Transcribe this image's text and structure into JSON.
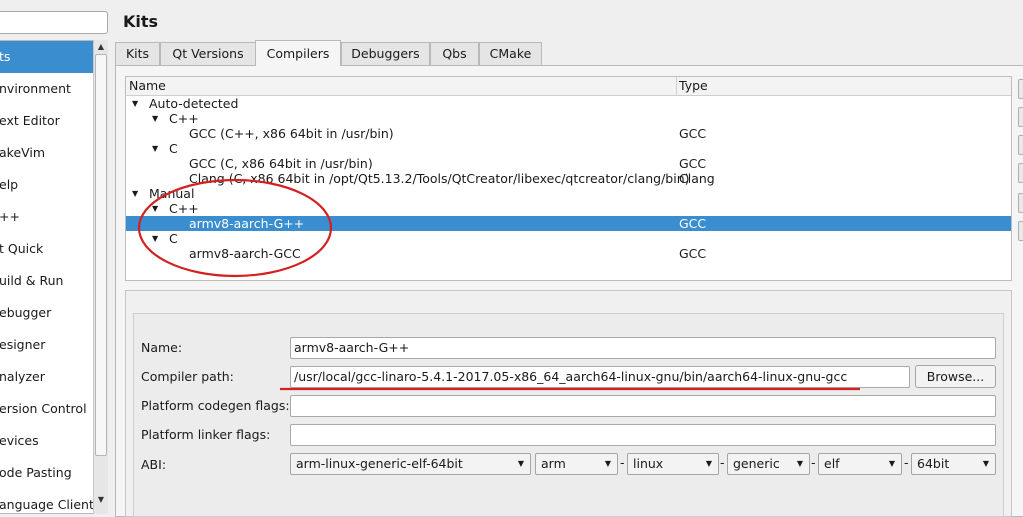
{
  "page_title": "Kits",
  "sidebar": {
    "items": [
      {
        "label": "ts",
        "selected": true
      },
      {
        "label": "nvironment",
        "selected": false
      },
      {
        "label": "ext Editor",
        "selected": false
      },
      {
        "label": "akeVim",
        "selected": false
      },
      {
        "label": "elp",
        "selected": false
      },
      {
        "label": "++",
        "selected": false
      },
      {
        "label": "t Quick",
        "selected": false
      },
      {
        "label": "uild & Run",
        "selected": false
      },
      {
        "label": "ebugger",
        "selected": false
      },
      {
        "label": "esigner",
        "selected": false
      },
      {
        "label": "nalyzer",
        "selected": false
      },
      {
        "label": "ersion Control",
        "selected": false
      },
      {
        "label": "evices",
        "selected": false
      },
      {
        "label": "ode Pasting",
        "selected": false
      },
      {
        "label": "anguage Client",
        "selected": false
      }
    ]
  },
  "tabs": [
    {
      "label": "Kits"
    },
    {
      "label": "Qt Versions"
    },
    {
      "label": "Compilers"
    },
    {
      "label": "Debuggers"
    },
    {
      "label": "Qbs"
    },
    {
      "label": "CMake"
    }
  ],
  "active_tab": "Compilers",
  "tree": {
    "columns": [
      "Name",
      "Type"
    ],
    "rows": [
      {
        "name": "Auto-detected",
        "type": "",
        "expanded": true
      },
      {
        "name": "C++",
        "type": "",
        "expanded": true
      },
      {
        "name": "GCC (C++, x86 64bit in /usr/bin)",
        "type": "GCC"
      },
      {
        "name": "C",
        "type": "",
        "expanded": true
      },
      {
        "name": "GCC (C, x86 64bit in /usr/bin)",
        "type": "GCC"
      },
      {
        "name": "Clang (C, x86 64bit in /opt/Qt5.13.2/Tools/QtCreator/libexec/qtcreator/clang/bin)",
        "type": "Clang"
      },
      {
        "name": "Manual",
        "type": "",
        "expanded": true
      },
      {
        "name": "C++",
        "type": "",
        "expanded": true
      },
      {
        "name": "armv8-aarch-G++",
        "type": "GCC",
        "selected": true
      },
      {
        "name": "C",
        "type": "",
        "expanded": true
      },
      {
        "name": "armv8-aarch-GCC",
        "type": "GCC"
      }
    ]
  },
  "details": {
    "name_label": "Name:",
    "name_value": "armv8-aarch-G++",
    "compiler_path_label": "Compiler path:",
    "compiler_path_value": "/usr/local/gcc-linaro-5.4.1-2017.05-x86_64_aarch64-linux-gnu/bin/aarch64-linux-gnu-gcc",
    "browse_label": "Browse...",
    "codegen_label": "Platform codegen flags:",
    "codegen_value": "",
    "linker_label": "Platform linker flags:",
    "linker_value": "",
    "abi_label": "ABI:",
    "abi_combos": [
      "arm-linux-generic-elf-64bit",
      "arm",
      "linux",
      "generic",
      "elf",
      "64bit"
    ],
    "abi_separator": "-"
  },
  "colors": {
    "selection": "#3a8ed0",
    "annotation_red": "#d42020"
  }
}
